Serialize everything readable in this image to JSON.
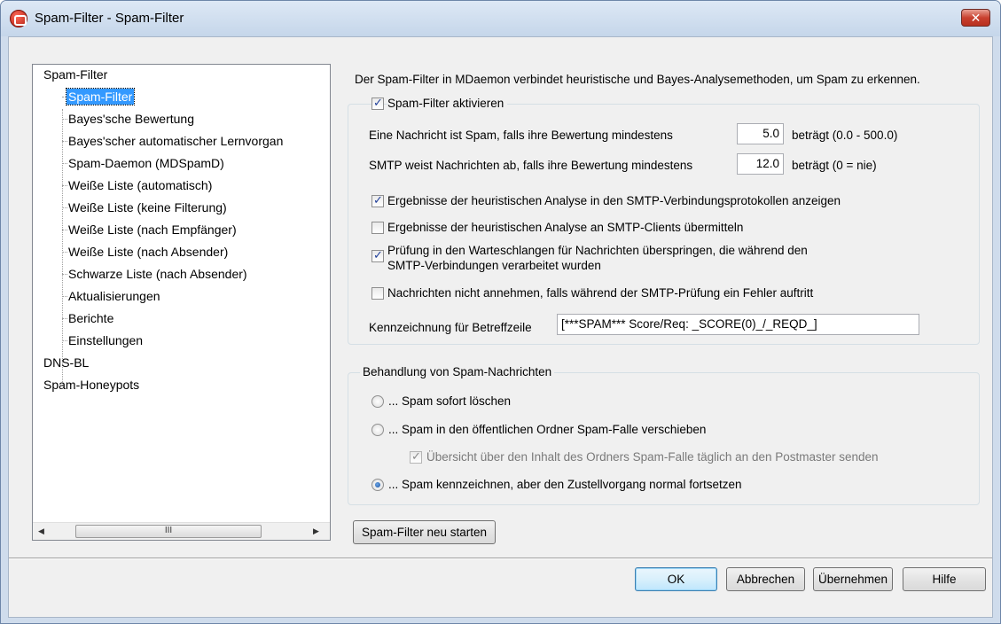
{
  "window": {
    "title": "Spam-Filter - Spam-Filter",
    "close_glyph": "✕"
  },
  "tree": {
    "root1": "Spam-Filter",
    "children": [
      "Spam-Filter",
      "Bayes'sche Bewertung",
      "Bayes'scher automatischer Lernvorgan",
      "Spam-Daemon (MDSpamD)",
      "Weiße Liste (automatisch)",
      "Weiße Liste (keine Filterung)",
      "Weiße Liste (nach Empfänger)",
      "Weiße Liste (nach Absender)",
      "Schwarze Liste (nach Absender)",
      "Aktualisierungen",
      "Berichte",
      "Einstellungen"
    ],
    "root2": "DNS-BL",
    "root3": "Spam-Honeypots",
    "scroll_left": "◀",
    "scroll_right": "▶",
    "scroll_grip": "III"
  },
  "intro": "Der Spam-Filter in MDaemon verbindet heuristische und Bayes-Analysemethoden, um Spam zu erkennen.",
  "settings": {
    "enable_label": "Spam-Filter aktivieren",
    "threshold_label": "Eine Nachricht ist Spam, falls ihre Bewertung mindestens",
    "threshold_value": "5.0",
    "threshold_suffix": "beträgt (0.0 - 500.0)",
    "smtp_label": "SMTP weist Nachrichten ab, falls ihre Bewertung mindestens",
    "smtp_value": "12.0",
    "smtp_suffix": "beträgt (0 = nie)",
    "opt1": "Ergebnisse der heuristischen Analyse in den SMTP-Verbindungsprotokollen anzeigen",
    "opt2": "Ergebnisse der heuristischen Analyse an SMTP-Clients übermitteln",
    "opt3_line1": "Prüfung in den Warteschlangen für Nachrichten überspringen, die während den",
    "opt3_line2": "SMTP-Verbindungen verarbeitet wurden",
    "opt4": "Nachrichten nicht annehmen, falls während der SMTP-Prüfung ein Fehler auftritt",
    "subject_label": "Kennzeichnung für Betreffzeile",
    "subject_value": "[***SPAM*** Score/Req: _SCORE(0)_/_REQD_]"
  },
  "handling": {
    "group_label": "Behandlung von Spam-Nachrichten",
    "opt_delete": "... Spam sofort löschen",
    "opt_move": "... Spam in den öffentlichen Ordner Spam-Falle verschieben",
    "sub_summary": "Übersicht über den Inhalt des Ordners Spam-Falle täglich an den Postmaster senden",
    "opt_tag": "... Spam kennzeichnen, aber den Zustellvorgang normal fortsetzen"
  },
  "restart_button": "Spam-Filter neu starten",
  "buttons": {
    "ok": "OK",
    "cancel": "Abbrechen",
    "apply": "Übernehmen",
    "help": "Hilfe"
  }
}
